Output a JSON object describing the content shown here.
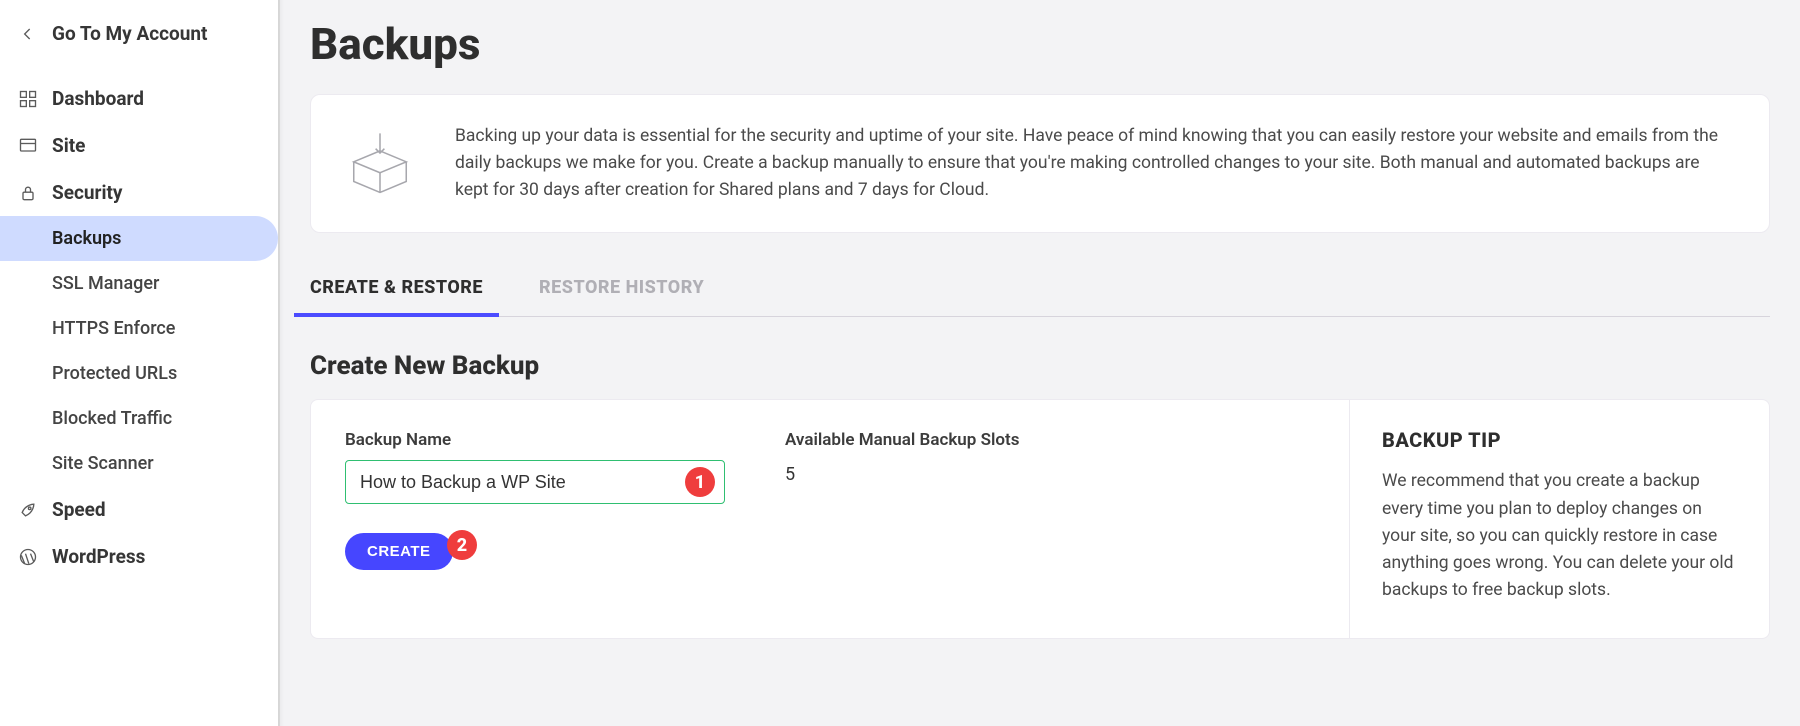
{
  "sidebar": {
    "back_label": "Go To My Account",
    "items": [
      {
        "label": "Dashboard"
      },
      {
        "label": "Site"
      },
      {
        "label": "Security"
      },
      {
        "label": "Speed"
      },
      {
        "label": "WordPress"
      }
    ],
    "security_sub": [
      {
        "label": "Backups"
      },
      {
        "label": "SSL Manager"
      },
      {
        "label": "HTTPS Enforce"
      },
      {
        "label": "Protected URLs"
      },
      {
        "label": "Blocked Traffic"
      },
      {
        "label": "Site Scanner"
      }
    ]
  },
  "page": {
    "title": "Backups",
    "info": "Backing up your data is essential for the security and uptime of your site. Have peace of mind knowing that you can easily restore your website and emails from the daily backups we make for you. Create a backup manually to ensure that you're making controlled changes to your site. Both manual and automated backups are kept for 30 days after creation for Shared plans and 7 days for Cloud."
  },
  "tabs": {
    "create_restore": "CREATE & RESTORE",
    "restore_history": "RESTORE HISTORY"
  },
  "create": {
    "section_title": "Create New Backup",
    "name_label": "Backup Name",
    "name_value": "How to Backup a WP Site",
    "slots_label": "Available Manual Backup Slots",
    "slots_value": "5",
    "button": "CREATE",
    "badge1": "1",
    "badge2": "2"
  },
  "tip": {
    "title": "BACKUP TIP",
    "text": "We recommend that you create a backup every time you plan to deploy changes on your site, so you can quickly restore in case anything goes wrong. You can delete your old backups to free backup slots."
  }
}
